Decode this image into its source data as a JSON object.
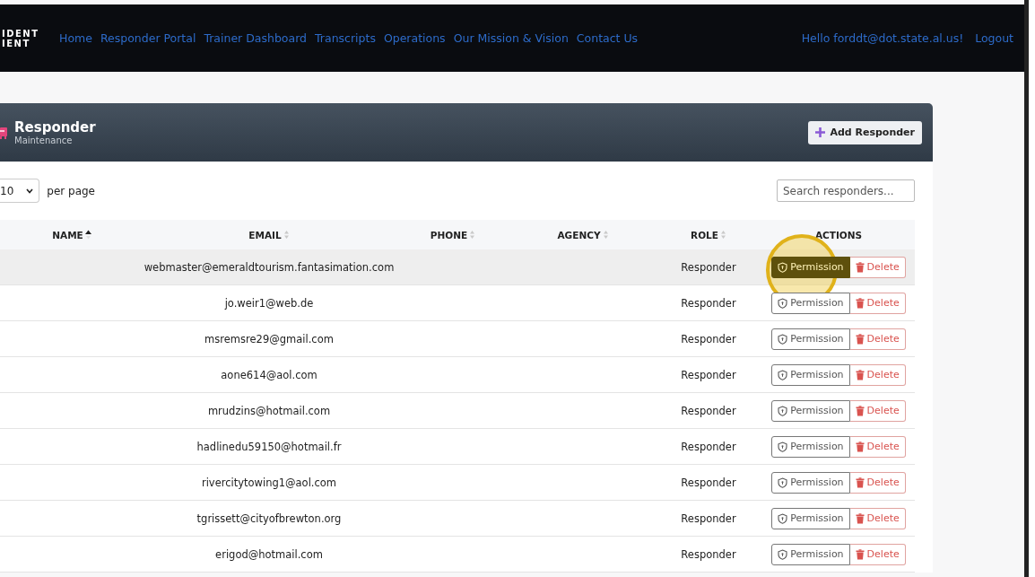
{
  "navbar": {
    "brand_lines": [
      "IDENT",
      "IENT"
    ],
    "links": [
      "Home",
      "Responder Portal",
      "Trainer Dashboard",
      "Transcripts",
      "Operations",
      "Our Mission & Vision",
      "Contact Us"
    ],
    "greeting": "Hello forddt@dot.state.al.us!",
    "logout": "Logout"
  },
  "card": {
    "title": "Responder",
    "subtitle": "Maintenance",
    "add_button": "Add Responder",
    "per_page": {
      "value": "10",
      "label": "per page"
    },
    "search": {
      "placeholder": "Search responders..."
    },
    "table": {
      "columns": [
        {
          "label": "NAME",
          "sortable": true,
          "sorted": true
        },
        {
          "label": "EMAIL",
          "sortable": true,
          "sorted": false
        },
        {
          "label": "PHONE",
          "sortable": true,
          "sorted": false
        },
        {
          "label": "AGENCY",
          "sortable": true,
          "sorted": false
        },
        {
          "label": "ROLE",
          "sortable": true,
          "sorted": false
        },
        {
          "label": "ACTIONS",
          "sortable": false
        }
      ],
      "rows": [
        {
          "email": "webmaster@emeraldtourism.fantasimation.com",
          "role": "Responder",
          "highlighted": true,
          "permission": "Permission",
          "delete": "Delete"
        },
        {
          "email": "jo.weir1@web.de",
          "role": "Responder",
          "highlighted": false,
          "permission": "Permission",
          "delete": "Delete"
        },
        {
          "email": "msremsre29@gmail.com",
          "role": "Responder",
          "highlighted": false,
          "permission": "Permission",
          "delete": "Delete"
        },
        {
          "email": "aone614@aol.com",
          "role": "Responder",
          "highlighted": false,
          "permission": "Permission",
          "delete": "Delete"
        },
        {
          "email": "mrudzins@hotmail.com",
          "role": "Responder",
          "highlighted": false,
          "permission": "Permission",
          "delete": "Delete"
        },
        {
          "email": "hadlinedu59150@hotmail.fr",
          "role": "Responder",
          "highlighted": false,
          "permission": "Permission",
          "delete": "Delete"
        },
        {
          "email": "rivercitytowing1@aol.com",
          "role": "Responder",
          "highlighted": false,
          "permission": "Permission",
          "delete": "Delete"
        },
        {
          "email": "tgrissett@cityofbrewton.org",
          "role": "Responder",
          "highlighted": false,
          "permission": "Permission",
          "delete": "Delete"
        },
        {
          "email": "erigod@hotmail.com",
          "role": "Responder",
          "highlighted": false,
          "permission": "Permission",
          "delete": "Delete"
        }
      ]
    }
  }
}
